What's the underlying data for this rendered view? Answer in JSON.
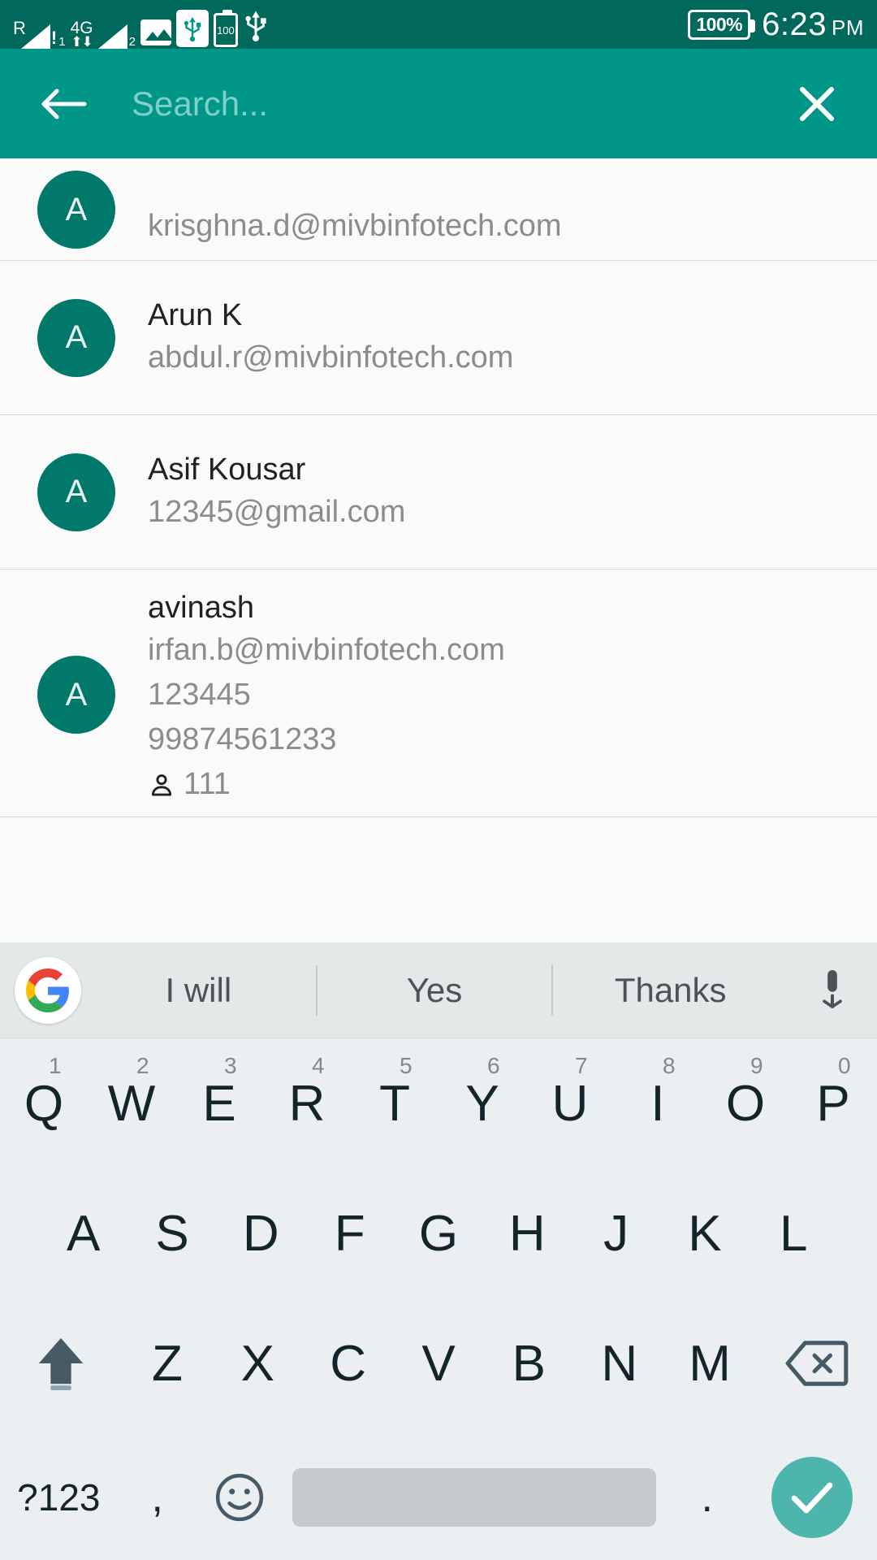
{
  "status_bar": {
    "roaming_label": "R",
    "network_label": "4G",
    "sim1_index": "1",
    "sim2_index": "2",
    "battery_percent": "100%",
    "battery_small_label": "100",
    "time": "6:23",
    "am_pm": "PM",
    "icons": [
      "signal-bar-sim1-icon",
      "network-4g-icon",
      "signal-bar-sim2-icon",
      "image-icon",
      "usb-connected-icon",
      "battery-saver-icon",
      "usb-icon"
    ]
  },
  "app_bar": {
    "back_label": "back-arrow",
    "search_value": "",
    "search_placeholder": "Search...",
    "clear_label": "close",
    "background_color": "#009688"
  },
  "contacts": [
    {
      "initial": "A",
      "name": "",
      "email": "krisghna.d@mivbinfotech.com",
      "numbers": [],
      "group_count": null
    },
    {
      "initial": "A",
      "name": "Arun K",
      "email": "abdul.r@mivbinfotech.com",
      "numbers": [],
      "group_count": null
    },
    {
      "initial": "A",
      "name": "Asif Kousar",
      "email": "12345@gmail.com",
      "numbers": [],
      "group_count": null
    },
    {
      "initial": "A",
      "name": "avinash",
      "email": "irfan.b@mivbinfotech.com",
      "numbers": [
        "123445",
        "99874561233"
      ],
      "group_count": "111"
    }
  ],
  "keyboard": {
    "suggestions": [
      "I will",
      "Yes",
      "Thanks"
    ],
    "logo": "google-logo",
    "mic": "microphone-icon",
    "row1": [
      {
        "letter": "Q",
        "num": "1"
      },
      {
        "letter": "W",
        "num": "2"
      },
      {
        "letter": "E",
        "num": "3"
      },
      {
        "letter": "R",
        "num": "4"
      },
      {
        "letter": "T",
        "num": "5"
      },
      {
        "letter": "Y",
        "num": "6"
      },
      {
        "letter": "U",
        "num": "7"
      },
      {
        "letter": "I",
        "num": "8"
      },
      {
        "letter": "O",
        "num": "9"
      },
      {
        "letter": "P",
        "num": "0"
      }
    ],
    "row2": [
      "A",
      "S",
      "D",
      "F",
      "G",
      "H",
      "J",
      "K",
      "L"
    ],
    "row3": [
      "Z",
      "X",
      "C",
      "V",
      "B",
      "N",
      "M"
    ],
    "shift_label": "shift-icon",
    "delete_label": "backspace-icon",
    "symbols_label": "?123",
    "comma_label": ",",
    "emoji_label": "emoji-icon",
    "space_label": "",
    "period_label": ".",
    "enter_label": "checkmark-icon",
    "enter_color": "#4db6ac"
  }
}
